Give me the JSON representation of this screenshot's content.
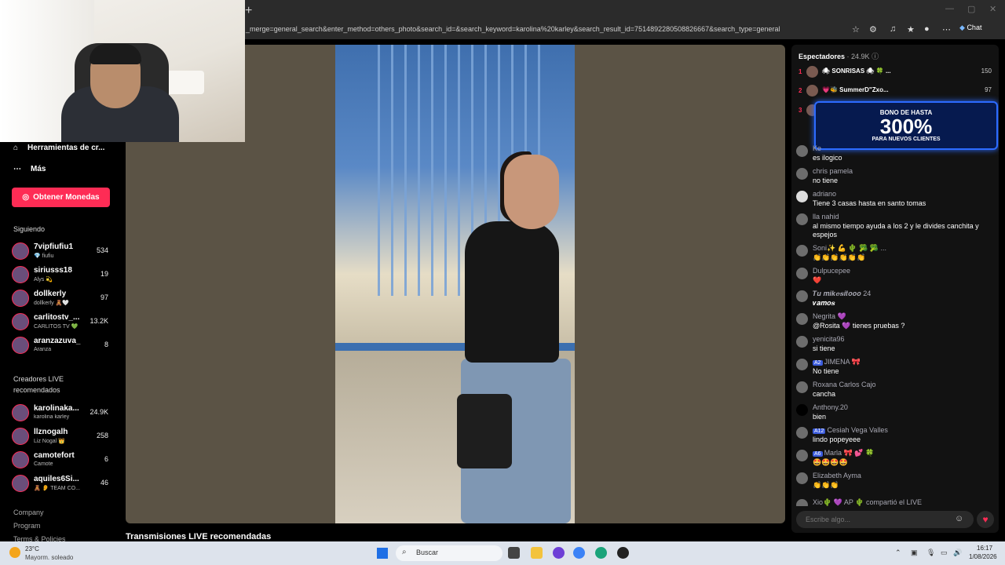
{
  "browser": {
    "new_tab_symbol": "+",
    "url": "_merge=general_search&enter_method=others_photo&search_id=&search_keyword=karolina%20karley&search_result_id=7514892280508826667&search_type=general",
    "chat_label": "Chat"
  },
  "sidebar": {
    "nav": [
      {
        "label": "Herramientas de cr..."
      },
      {
        "label": "Más"
      }
    ],
    "coins_button": "Obtener Monedas",
    "following_title": "Siguiendo",
    "following": [
      {
        "name": "7vipfiufiu1",
        "sub": "💎 fiufiu",
        "count": "534"
      },
      {
        "name": "siriusss18",
        "sub": "Alys 💫",
        "count": "19"
      },
      {
        "name": "dollkerly",
        "sub": "dollkerly 🧸🤍",
        "count": "97"
      },
      {
        "name": "carlitostv_...",
        "sub": "CARLITOS TV 💚",
        "count": "13.2K"
      },
      {
        "name": "aranzazuva_",
        "sub": "Aranza",
        "count": "8"
      }
    ],
    "creators_title": "Creadores LIVE recomendados",
    "creators": [
      {
        "name": "karolinaka...",
        "sub": "karolina karley",
        "count": "24.9K"
      },
      {
        "name": "llznogalh",
        "sub": "Liz Nogal 👑",
        "count": "258"
      },
      {
        "name": "camotefort",
        "sub": "Camote",
        "count": "6"
      },
      {
        "name": "aquiles6Si...",
        "sub": "🧸 👂 TEAM CO...",
        "count": "46"
      }
    ],
    "footer": [
      "Company",
      "Program",
      "Terms & Policies"
    ]
  },
  "main": {
    "below_title": "Transmisiones LIVE recomendadas"
  },
  "chat": {
    "viewers_label": "Espectadores",
    "viewers_count": "· 24.9K",
    "ranking": [
      {
        "rank": "1",
        "name": "🕷 SONRISAS 🕷 🍀 ...",
        "score": "150"
      },
      {
        "rank": "2",
        "name": "💗🐝 SummerD\"Zxo...",
        "score": "97"
      },
      {
        "rank": "3",
        "name": "",
        "score": ""
      }
    ],
    "ad": {
      "line1": "BONO DE HASTA",
      "line2": "300%",
      "line3": "PARA NUEVOS CLIENTES"
    },
    "messages": [
      {
        "user": "Ke",
        "text": "es ilogico"
      },
      {
        "user": "chris pamela",
        "text": "no tiene"
      },
      {
        "user": "adriano",
        "text": "Tiene 3 casas hasta en santo tomas"
      },
      {
        "user": "lla nahid",
        "text": "al mismo tiempo ayuda a los 2 y le divides canchita y espejos"
      },
      {
        "user": "Soni✨ 💪 🌵 🥦 🥦 ...",
        "text": "👏👏👏👏👏👏"
      },
      {
        "user": "Dulpucepee",
        "text": "❤️"
      },
      {
        "user": "𝑻𝒖 𝒎𝒊𝒌𝒆𝒔𝒊𝒕𝒐𝒐𝒐 24",
        "text": "𝒗𝒂𝒎𝒐𝒔"
      },
      {
        "user": "Negrita 💜",
        "text": "@Rosita 💜 tienes pruebas ?"
      },
      {
        "user": "yenicita96",
        "text": "si tiene"
      },
      {
        "badge": "A2",
        "user": "JIMENA 🎀",
        "text": "No tiene"
      },
      {
        "user": "Roxana Carlos Cajo",
        "text": "cancha"
      },
      {
        "user": "Anthony.20",
        "text": "bien"
      },
      {
        "badge": "A12",
        "user": "Cesiah Vega Valles",
        "text": "lindo popeyeee"
      },
      {
        "badge": "A6",
        "user": "Marla 🎀 💕 🍀",
        "text": "🤩🤩🤩🤩"
      },
      {
        "user": "Elizabeth Ayma",
        "text": "👏👏👏"
      },
      {
        "user": "Xio🌵 💜 AP 🌵",
        "text": "compartió el LIVE"
      }
    ],
    "input_placeholder": "Escribe algo..."
  },
  "taskbar": {
    "temp": "23°C",
    "weather": "Mayorm. soleado",
    "search": "Buscar",
    "time": "16:17",
    "date": "1/08/2026"
  }
}
